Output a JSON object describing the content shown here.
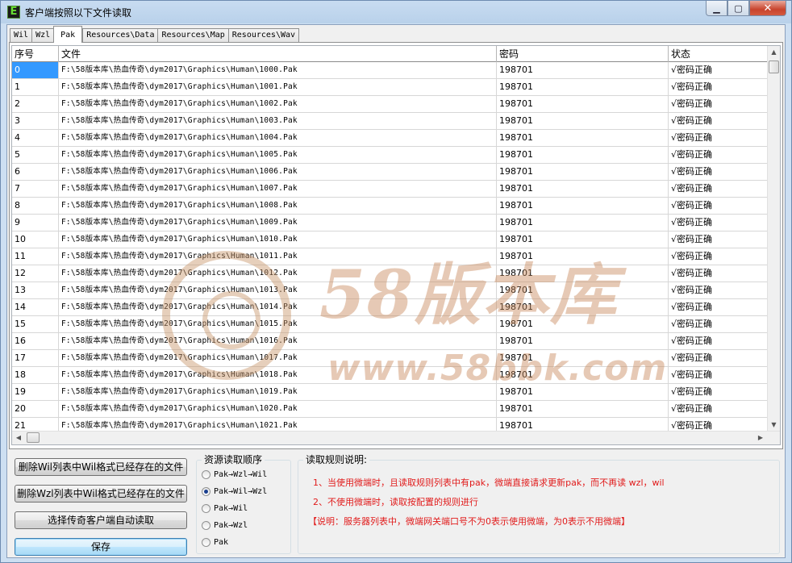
{
  "window": {
    "title": "客户端按照以下文件读取",
    "icon": "E",
    "minimize": "▁",
    "maximize": "▢",
    "close": "✕"
  },
  "tabs": [
    "Wil",
    "Wzl",
    "Pak",
    "Resources\\Data",
    "Resources\\Map",
    "Resources\\Wav"
  ],
  "active_tab": "Pak",
  "grid": {
    "columns": [
      "序号",
      "文件",
      "密码",
      "状态"
    ],
    "rows": [
      [
        "0",
        "F:\\58版本库\\热血传奇\\dym2017\\Graphics\\Human\\1000.Pak",
        "198701",
        "√密码正确"
      ],
      [
        "1",
        "F:\\58版本库\\热血传奇\\dym2017\\Graphics\\Human\\1001.Pak",
        "198701",
        "√密码正确"
      ],
      [
        "2",
        "F:\\58版本库\\热血传奇\\dym2017\\Graphics\\Human\\1002.Pak",
        "198701",
        "√密码正确"
      ],
      [
        "3",
        "F:\\58版本库\\热血传奇\\dym2017\\Graphics\\Human\\1003.Pak",
        "198701",
        "√密码正确"
      ],
      [
        "4",
        "F:\\58版本库\\热血传奇\\dym2017\\Graphics\\Human\\1004.Pak",
        "198701",
        "√密码正确"
      ],
      [
        "5",
        "F:\\58版本库\\热血传奇\\dym2017\\Graphics\\Human\\1005.Pak",
        "198701",
        "√密码正确"
      ],
      [
        "6",
        "F:\\58版本库\\热血传奇\\dym2017\\Graphics\\Human\\1006.Pak",
        "198701",
        "√密码正确"
      ],
      [
        "7",
        "F:\\58版本库\\热血传奇\\dym2017\\Graphics\\Human\\1007.Pak",
        "198701",
        "√密码正确"
      ],
      [
        "8",
        "F:\\58版本库\\热血传奇\\dym2017\\Graphics\\Human\\1008.Pak",
        "198701",
        "√密码正确"
      ],
      [
        "9",
        "F:\\58版本库\\热血传奇\\dym2017\\Graphics\\Human\\1009.Pak",
        "198701",
        "√密码正确"
      ],
      [
        "10",
        "F:\\58版本库\\热血传奇\\dym2017\\Graphics\\Human\\1010.Pak",
        "198701",
        "√密码正确"
      ],
      [
        "11",
        "F:\\58版本库\\热血传奇\\dym2017\\Graphics\\Human\\1011.Pak",
        "198701",
        "√密码正确"
      ],
      [
        "12",
        "F:\\58版本库\\热血传奇\\dym2017\\Graphics\\Human\\1012.Pak",
        "198701",
        "√密码正确"
      ],
      [
        "13",
        "F:\\58版本库\\热血传奇\\dym2017\\Graphics\\Human\\1013.Pak",
        "198701",
        "√密码正确"
      ],
      [
        "14",
        "F:\\58版本库\\热血传奇\\dym2017\\Graphics\\Human\\1014.Pak",
        "198701",
        "√密码正确"
      ],
      [
        "15",
        "F:\\58版本库\\热血传奇\\dym2017\\Graphics\\Human\\1015.Pak",
        "198701",
        "√密码正确"
      ],
      [
        "16",
        "F:\\58版本库\\热血传奇\\dym2017\\Graphics\\Human\\1016.Pak",
        "198701",
        "√密码正确"
      ],
      [
        "17",
        "F:\\58版本库\\热血传奇\\dym2017\\Graphics\\Human\\1017.Pak",
        "198701",
        "√密码正确"
      ],
      [
        "18",
        "F:\\58版本库\\热血传奇\\dym2017\\Graphics\\Human\\1018.Pak",
        "198701",
        "√密码正确"
      ],
      [
        "19",
        "F:\\58版本库\\热血传奇\\dym2017\\Graphics\\Human\\1019.Pak",
        "198701",
        "√密码正确"
      ],
      [
        "20",
        "F:\\58版本库\\热血传奇\\dym2017\\Graphics\\Human\\1020.Pak",
        "198701",
        "√密码正确"
      ],
      [
        "21",
        "F:\\58版本库\\热血传奇\\dym2017\\Graphics\\Human\\1021.Pak",
        "198701",
        "√密码正确"
      ]
    ],
    "selected_row": 0
  },
  "watermark": {
    "title": "58版本库",
    "url": "www.58bbk.com"
  },
  "buttons": {
    "delete_wil": "删除Wil列表中Wil格式已经存在的文件",
    "delete_wzl": "删除Wzl列表中Wil格式已经存在的文件",
    "auto_read": "选择传奇客户端自动读取",
    "save": "保存"
  },
  "read_order": {
    "title": "资源读取顺序",
    "options": [
      "Pak→Wzl→Wil",
      "Pak→Wil→Wzl",
      "Pak→Wil",
      "Pak→Wzl",
      "Pak"
    ],
    "selected_index": 1
  },
  "rules": {
    "title": "读取规则说明:",
    "line1": "1、当使用微端时，且读取规则列表中有pak，微端直接请求更新pak，而不再读 wzl，wil",
    "line2": "2、不使用微端时，读取按配置的规则进行",
    "line3": "【说明：服务器列表中，微端网关端口号不为0表示使用微端，为0表示不用微端】"
  },
  "colors": {
    "selection": "#3399ff",
    "rule_text": "#e11b1b",
    "close_button": "#c8442d"
  }
}
